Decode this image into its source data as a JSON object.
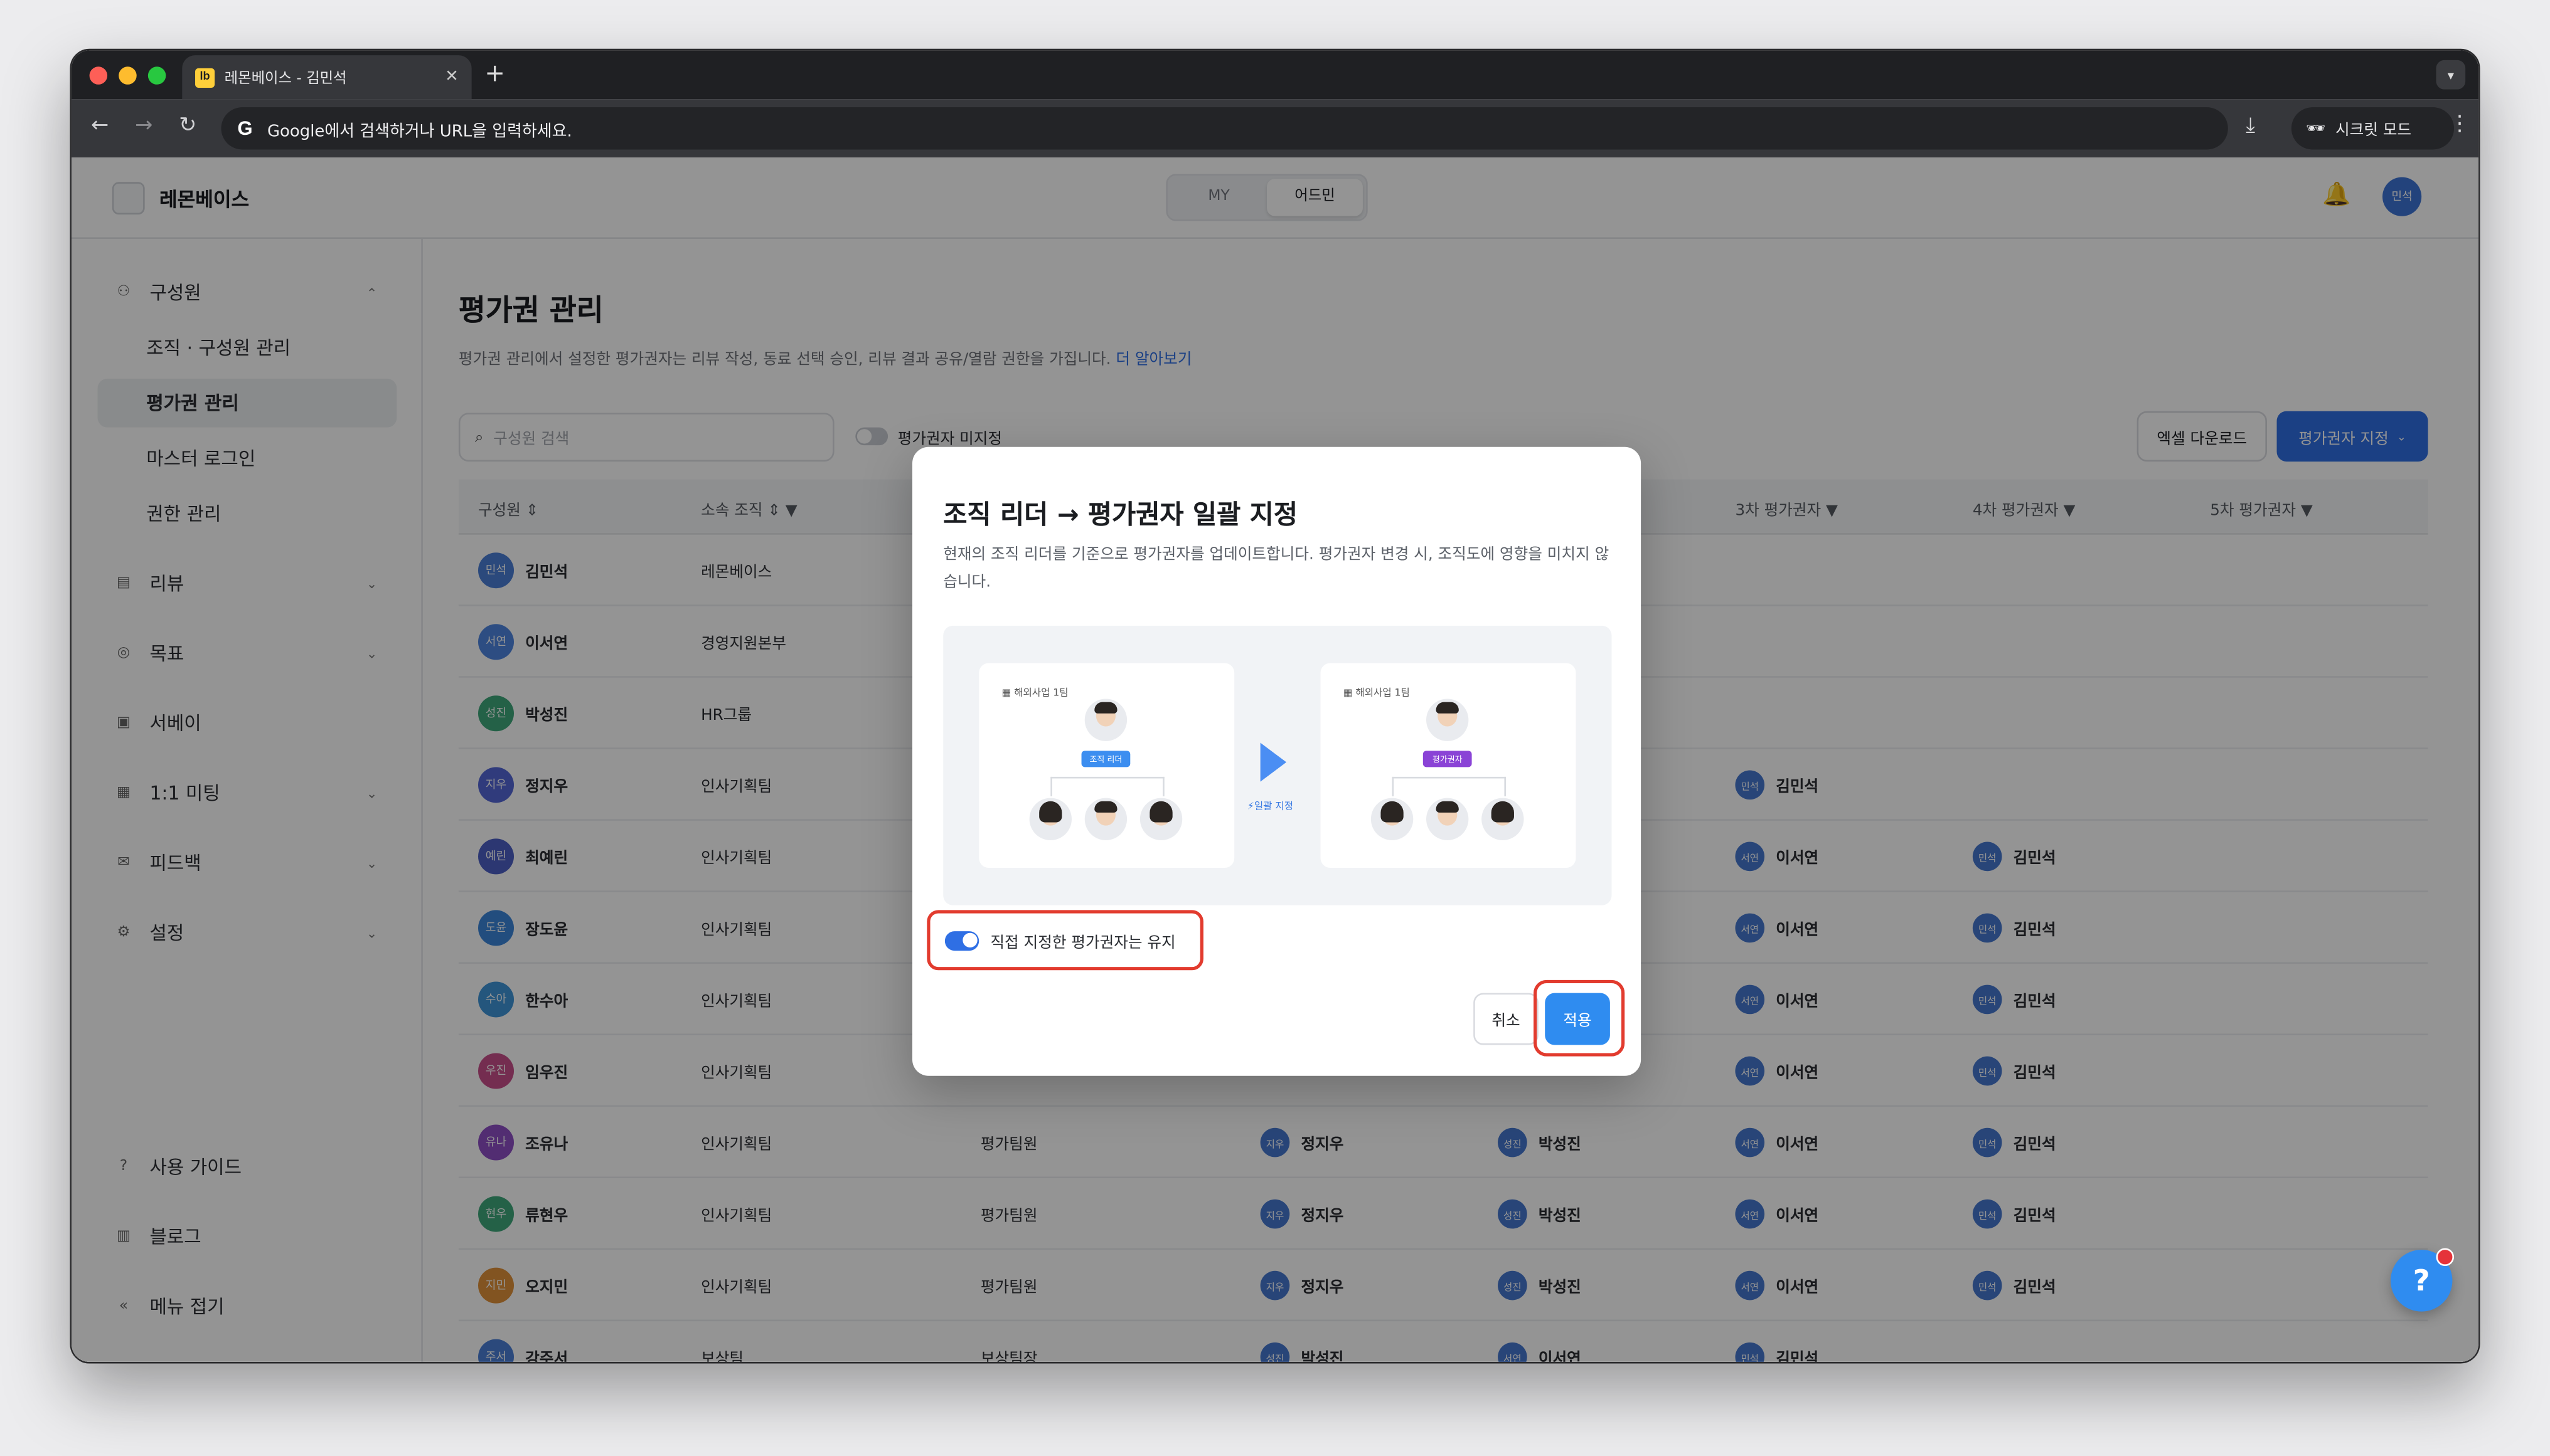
{
  "browser": {
    "tab_title": "레몬베이스 - 김민석",
    "favicon_text": "lb",
    "address_placeholder": "Google에서 검색하거나 URL을 입력하세요.",
    "incognito_label": "시크릿 모드"
  },
  "header": {
    "app_name": "레몬베이스",
    "mode_tabs": [
      "MY",
      "어드민"
    ],
    "active_mode": "어드민",
    "user_initials": "민석"
  },
  "sidebar": {
    "group_members": "구성원",
    "sub_org": "조직 · 구성원 관리",
    "sub_eval": "평가권 관리",
    "sub_master": "마스터 로그인",
    "sub_perm": "권한 관리",
    "review": "리뷰",
    "goal": "목표",
    "survey": "서베이",
    "meeting": "1:1 미팅",
    "feedback": "피드백",
    "settings": "설정",
    "guide": "사용 가이드",
    "blog": "블로그",
    "collapse": "메뉴 접기"
  },
  "page": {
    "title": "평가권 관리",
    "description": "평가권 관리에서 설정한 평가권자는 리뷰 작성, 동료 선택 승인, 리뷰 결과 공유/열람 권한을 가집니다.",
    "learn_more": "더 알아보기",
    "search_placeholder": "구성원 검색",
    "unassigned_toggle_label": "평가권자 미지정",
    "excel_button": "엑셀 다운로드",
    "assign_button": "평가권자 지정"
  },
  "table": {
    "headers": {
      "member": "구성원",
      "org": "소속 조직",
      "third": "3차 평가권자",
      "fourth": "4차 평가권자",
      "fifth": "5차 평가권자"
    },
    "rows": [
      {
        "initials": "민석",
        "name": "김민석",
        "color": "#4a7fd6",
        "org": "레몬베이스",
        "team": "",
        "e1": "",
        "e1i": "",
        "e2": "",
        "e2i": "",
        "e3": "",
        "e3i": "",
        "e4": "",
        "e4i": ""
      },
      {
        "initials": "서연",
        "name": "이서연",
        "color": "#4f86e0",
        "org": "경영지원본부",
        "team": "",
        "e1": "",
        "e1i": "",
        "e2": "",
        "e2i": "",
        "e3": "",
        "e3i": "",
        "e4": "",
        "e4i": ""
      },
      {
        "initials": "성진",
        "name": "박성진",
        "color": "#3fa77a",
        "org": "HR그룹",
        "team": "",
        "e1": "",
        "e1i": "",
        "e2": "",
        "e2i": "",
        "e3": "",
        "e3i": "",
        "e4": "",
        "e4i": ""
      },
      {
        "initials": "지우",
        "name": "정지우",
        "color": "#5466d6",
        "org": "인사기획팀",
        "team": "",
        "e1": "",
        "e1i": "",
        "e2": "",
        "e2i": "",
        "e3": "김민석",
        "e3i": "민석",
        "e4": "",
        "e4i": ""
      },
      {
        "initials": "예린",
        "name": "최예린",
        "color": "#4d5fc4",
        "org": "인사기획팀",
        "team": "",
        "e1": "",
        "e1i": "",
        "e2": "",
        "e2i": "",
        "e3": "이서연",
        "e3i": "서연",
        "e4": "김민석",
        "e4i": "민석"
      },
      {
        "initials": "도윤",
        "name": "장도윤",
        "color": "#3b86d9",
        "org": "인사기획팀",
        "team": "",
        "e1": "",
        "e1i": "",
        "e2": "",
        "e2i": "",
        "e3": "이서연",
        "e3i": "서연",
        "e4": "김민석",
        "e4i": "민석"
      },
      {
        "initials": "수아",
        "name": "한수아",
        "color": "#3f95d8",
        "org": "인사기획팀",
        "team": "",
        "e1": "",
        "e1i": "",
        "e2": "",
        "e2i": "",
        "e3": "이서연",
        "e3i": "서연",
        "e4": "김민석",
        "e4i": "민석"
      },
      {
        "initials": "우진",
        "name": "임우진",
        "color": "#c94f8a",
        "org": "인사기획팀",
        "team": "",
        "e1": "",
        "e1i": "",
        "e2": "",
        "e2i": "",
        "e3": "이서연",
        "e3i": "서연",
        "e4": "김민석",
        "e4i": "민석"
      },
      {
        "initials": "유나",
        "name": "조유나",
        "color": "#8e4fc4",
        "org": "인사기획팀",
        "team": "평가팀원",
        "e1": "정지우",
        "e1i": "지우",
        "e2": "박성진",
        "e2i": "성진",
        "e3": "이서연",
        "e3i": "서연",
        "e4": "김민석",
        "e4i": "민석"
      },
      {
        "initials": "현우",
        "name": "류현우",
        "color": "#3fa77a",
        "org": "인사기획팀",
        "team": "평가팀원",
        "e1": "정지우",
        "e1i": "지우",
        "e2": "박성진",
        "e2i": "성진",
        "e3": "이서연",
        "e3i": "서연",
        "e4": "김민석",
        "e4i": "민석"
      },
      {
        "initials": "지민",
        "name": "오지민",
        "color": "#e0923a",
        "org": "인사기획팀",
        "team": "평가팀원",
        "e1": "정지우",
        "e1i": "지우",
        "e2": "박성진",
        "e2i": "성진",
        "e3": "이서연",
        "e3i": "서연",
        "e4": "김민석",
        "e4i": "민석"
      },
      {
        "initials": "주서",
        "name": "강주서",
        "color": "#4a7fd6",
        "org": "보상팀",
        "team": "보상팀장",
        "e1": "박성진",
        "e1i": "성진",
        "e2": "이서연",
        "e2i": "서연",
        "e3": "김민석",
        "e3i": "민석",
        "e4": "",
        "e4i": ""
      }
    ]
  },
  "modal": {
    "title": "조직 리더 → 평가권자 일괄 지정",
    "description": "현재의 조직 리더를 기준으로 평가권자를 업데이트합니다. 평가권자 변경 시, 조직도에 영향을 미치지 않습니다.",
    "illus_team_label": "해외사업 1팀",
    "illus_before_badge": "조직 리더",
    "illus_after_badge": "평가권자",
    "illus_arrow_label": "일괄 지정",
    "keep_toggle_label": "직접 지정한 평가권자는 유지",
    "keep_toggle_on": true,
    "cancel_label": "취소",
    "apply_label": "적용"
  },
  "colors": {
    "primary": "#2f6fe4",
    "apply": "#2f8cf0",
    "highlight": "#e23b2e",
    "leader_badge": "#3c8ef0",
    "evaluator_badge": "#8a43d6"
  }
}
